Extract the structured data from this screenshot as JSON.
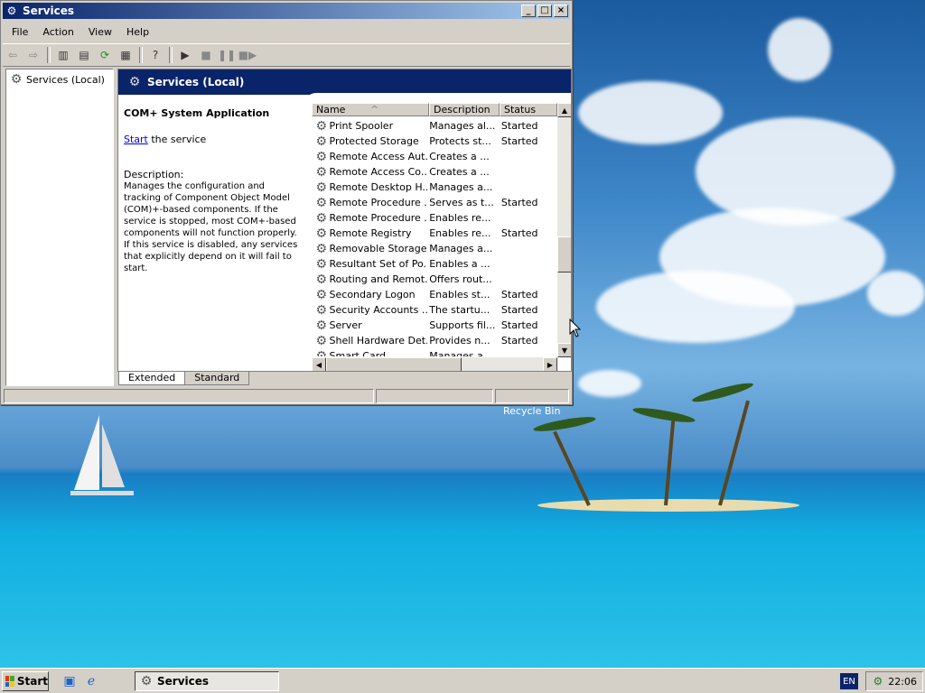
{
  "window": {
    "title": "Services",
    "buttons": {
      "minimize": "_",
      "maximize": "□",
      "close": "×"
    }
  },
  "menu": [
    "File",
    "Action",
    "View",
    "Help"
  ],
  "toolbar": {
    "icons": [
      "back-arrow-icon",
      "forward-arrow-icon",
      "show-hide-tree-icon",
      "properties-icon",
      "refresh-icon",
      "export-list-icon",
      "help-icon",
      "play-icon",
      "stop-icon",
      "pause-icon",
      "restart-icon"
    ]
  },
  "tree": {
    "root": "Services (Local)"
  },
  "content": {
    "header": "Services (Local)",
    "selected_service": "COM+ System Application",
    "start_link": "Start",
    "start_suffix": " the service",
    "description_label": "Description:",
    "description": "Manages the configuration and tracking of Component Object Model (COM)+-based components. If the service is stopped, most COM+-based components will not function properly. If this service is disabled, any services that explicitly depend on it will fail to start."
  },
  "list": {
    "columns": [
      "Name",
      "Description",
      "Status"
    ],
    "sort_indicator": "^",
    "rows": [
      {
        "name": "Print Spooler",
        "desc": "Manages al...",
        "status": "Started"
      },
      {
        "name": "Protected Storage",
        "desc": "Protects st...",
        "status": "Started"
      },
      {
        "name": "Remote Access Aut...",
        "desc": "Creates a ...",
        "status": ""
      },
      {
        "name": "Remote Access Co...",
        "desc": "Creates a ...",
        "status": ""
      },
      {
        "name": "Remote Desktop H...",
        "desc": "Manages a...",
        "status": ""
      },
      {
        "name": "Remote Procedure ...",
        "desc": "Serves as t...",
        "status": "Started"
      },
      {
        "name": "Remote Procedure ...",
        "desc": "Enables re...",
        "status": ""
      },
      {
        "name": "Remote Registry",
        "desc": "Enables re...",
        "status": "Started"
      },
      {
        "name": "Removable Storage",
        "desc": "Manages a...",
        "status": ""
      },
      {
        "name": "Resultant Set of Po...",
        "desc": "Enables a ...",
        "status": ""
      },
      {
        "name": "Routing and Remot...",
        "desc": "Offers rout...",
        "status": ""
      },
      {
        "name": "Secondary Logon",
        "desc": "Enables st...",
        "status": "Started"
      },
      {
        "name": "Security Accounts ...",
        "desc": "The startu...",
        "status": "Started"
      },
      {
        "name": "Server",
        "desc": "Supports fil...",
        "status": "Started"
      },
      {
        "name": "Shell Hardware Det...",
        "desc": "Provides n...",
        "status": "Started"
      },
      {
        "name": "Smart Card",
        "desc": "Manages a...",
        "status": ""
      }
    ]
  },
  "tabs": [
    "Extended",
    "Standard"
  ],
  "desktop": {
    "recycle_bin": "Recycle Bin"
  },
  "taskbar": {
    "start": "Start",
    "task": "Services",
    "language": "EN",
    "clock": "22:06"
  }
}
